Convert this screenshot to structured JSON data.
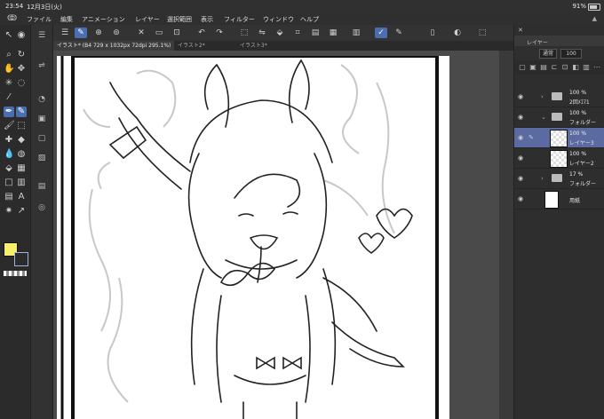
{
  "status": {
    "time": "23:54",
    "date": "12月3日(火)",
    "battery": "91%"
  },
  "menu": [
    "ファイル",
    "編集",
    "アニメーション",
    "レイヤー",
    "選択範囲",
    "表示",
    "フィルター",
    "ウィンドウ",
    "ヘルプ"
  ],
  "tabs": [
    {
      "label": "イラスト* (B4 729 x 1032px 72dpi 295.1%)",
      "current": true
    },
    {
      "label": "イラスト2*",
      "current": false
    },
    {
      "label": "イラスト3*",
      "current": false
    }
  ],
  "colors": {
    "foreground": "#f7ef6a",
    "accent": "#4a6eb0",
    "selected_layer": "#5b6aa0"
  },
  "layer_panel": {
    "title": "レイヤー",
    "blend": "通常",
    "opacity": "100",
    "layers": [
      {
        "pct": "100 %",
        "name": "2回ﾒｴﾏ1",
        "kind": "folder",
        "selected": false
      },
      {
        "pct": "100 %",
        "name": "フォルダー",
        "kind": "folder",
        "selected": false
      },
      {
        "pct": "100 %",
        "name": "レイヤー3",
        "kind": "raster",
        "selected": true
      },
      {
        "pct": "100 %",
        "name": "レイヤー2",
        "kind": "raster",
        "selected": false
      },
      {
        "pct": "17 %",
        "name": "フォルダー",
        "kind": "folder",
        "selected": false
      },
      {
        "pct": "",
        "name": "用紙",
        "kind": "paper",
        "selected": false
      }
    ]
  },
  "left_tools": [
    "cursor-icon",
    "zoom-icon",
    "move-icon",
    "hand-icon",
    "lasso-icon",
    "eyedropper-icon",
    "pen-icon",
    "pencil-icon",
    "brush-icon",
    "eraser-icon",
    "fill-icon",
    "gradient-icon",
    "shape-icon",
    "text-icon",
    "ruler-icon",
    "frame-icon",
    "correction-icon",
    "figure-icon"
  ]
}
